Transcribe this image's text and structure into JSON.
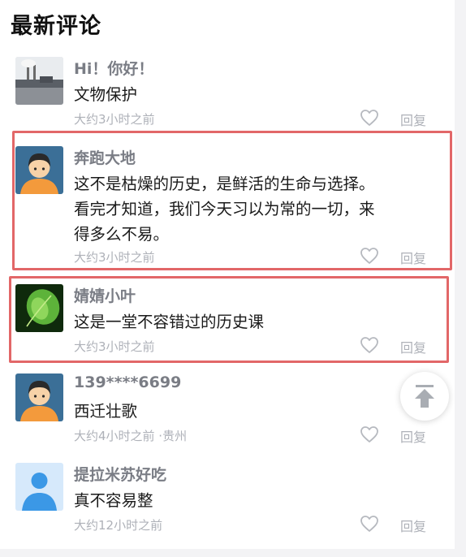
{
  "section": {
    "title": "最新评论"
  },
  "comments": [
    {
      "avatar": "factory-photo-avatar",
      "username": "Hi！你好！",
      "lines": [
        "文物保护"
      ],
      "time": "大约3小时之前",
      "reply": "回复"
    },
    {
      "avatar": "cartoon-boy-avatar",
      "username": "奔跑大地",
      "lines": [
        "这不是枯燥的历史，是鲜活的生命与选择。",
        "看完才知道，我们今天习以为常的一切，来",
        "得多么不易。"
      ],
      "time": "大约3小时之前",
      "reply": "回复"
    },
    {
      "avatar": "green-leaf-avatar",
      "username": "婧婧小叶",
      "lines": [
        "这是一堂不容错过的历史课"
      ],
      "time": "大约3小时之前",
      "reply": "回复"
    },
    {
      "avatar": "cartoon-boy-avatar",
      "username": "139****6699",
      "lines": [
        "西迁壮歌"
      ],
      "time": "大约4小时之前 ·贵州",
      "reply": "回复"
    },
    {
      "avatar": "default-person-avatar",
      "username": "提拉米苏好吃",
      "lines": [
        "真不容易整"
      ],
      "time": "大约12小时之前",
      "reply": "回复"
    }
  ],
  "scroll_top": {
    "icon": "arrow-up-to-top-icon"
  },
  "colors": {
    "highlight": "#e26768",
    "username": "#7a7d85",
    "meta": "#aeb1b8"
  }
}
